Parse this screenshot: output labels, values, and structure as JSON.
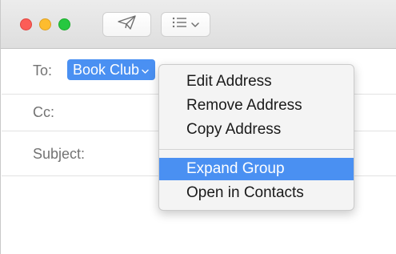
{
  "toolbar": {
    "traffic_lights": {
      "close_color": "#fc5d57",
      "minimize_color": "#fdbc2e",
      "zoom_color": "#27c840"
    },
    "send_icon": "paper-plane-icon",
    "format_icon": "list-icon",
    "format_dropdown_icon": "chevron-down-icon"
  },
  "compose": {
    "to_label": "To:",
    "to_recipient": "Book Club",
    "cc_label": "Cc:",
    "subject_label": "Subject:"
  },
  "context_menu": {
    "items": [
      {
        "label": "Edit Address"
      },
      {
        "label": "Remove Address"
      },
      {
        "label": "Copy Address"
      },
      {
        "label": "Expand Group",
        "selected": true
      },
      {
        "label": "Open in Contacts"
      }
    ]
  },
  "colors": {
    "accent": "#4a90f2",
    "label_gray": "#737373"
  }
}
